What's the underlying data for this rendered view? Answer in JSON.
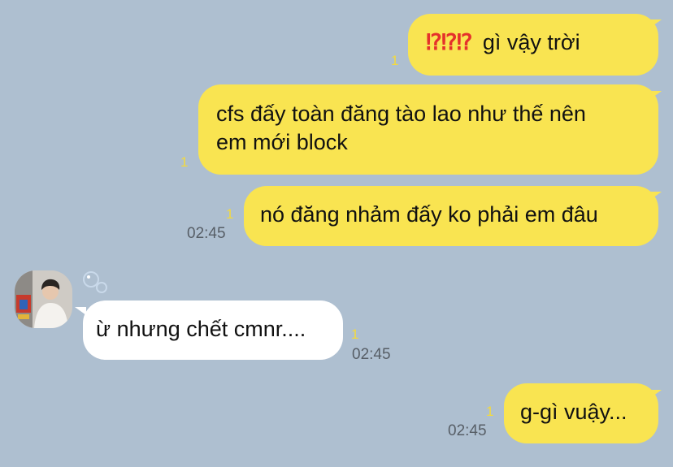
{
  "chat": {
    "messages": [
      {
        "id": "m1",
        "dir": "out",
        "emoji": "⁉⁉⁉",
        "text": "gì vậy trời",
        "read": "1"
      },
      {
        "id": "m2",
        "dir": "out",
        "line1": "cfs đấy toàn đăng tào lao như thế nên",
        "line2": "em mới block",
        "read": "1"
      },
      {
        "id": "m3",
        "dir": "out",
        "text": "nó đăng nhảm đấy ko phải em đâu",
        "read": "1",
        "time": "02:45"
      },
      {
        "id": "m4",
        "dir": "in",
        "text": "ừ nhưng chết cmnr....",
        "read": "1",
        "time": "02:45"
      },
      {
        "id": "m5",
        "dir": "out",
        "text": "g-gì vuậy...",
        "read": "1",
        "time": "02:45"
      }
    ]
  },
  "colors": {
    "background": "#aebfd0",
    "outgoing_bubble": "#f9e451",
    "incoming_bubble": "#ffffff",
    "read_count": "#f3da3e",
    "timestamp": "#575e66"
  },
  "icons": {
    "avatar": "profile-photo",
    "bubbles": "soap-bubbles-icon"
  }
}
